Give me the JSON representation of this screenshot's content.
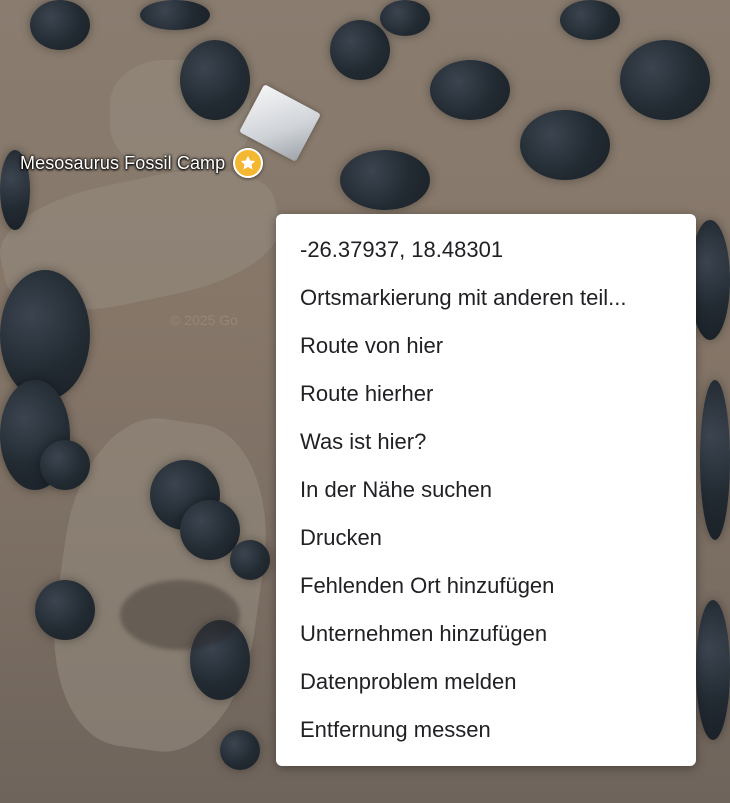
{
  "map": {
    "place_label": "Mesosaurus Fossil Camp",
    "pin_icon": "star-icon",
    "pin_color": "#f4b731",
    "watermark": "© 2025 Go"
  },
  "context_menu": {
    "items": [
      {
        "label": "-26.37937, 18.48301"
      },
      {
        "label": "Ortsmarkierung mit anderen teil..."
      },
      {
        "label": "Route von hier"
      },
      {
        "label": "Route hierher"
      },
      {
        "label": "Was ist hier?"
      },
      {
        "label": "In der Nähe suchen"
      },
      {
        "label": "Drucken"
      },
      {
        "label": "Fehlenden Ort hinzufügen"
      },
      {
        "label": "Unternehmen hinzufügen"
      },
      {
        "label": "Datenproblem melden"
      },
      {
        "label": "Entfernung messen"
      }
    ]
  }
}
